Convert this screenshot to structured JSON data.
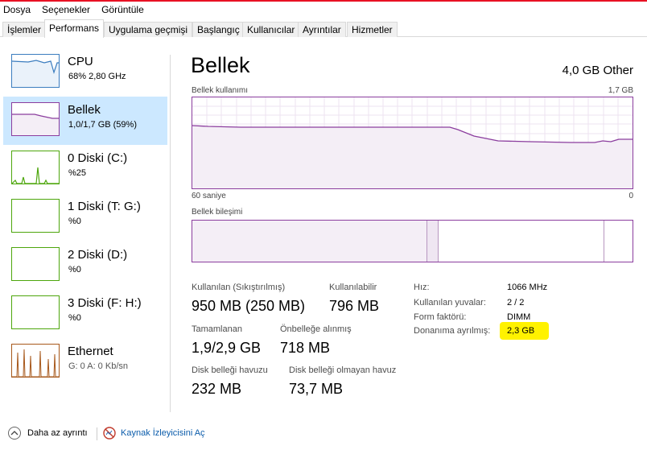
{
  "menu": [
    "Dosya",
    "Seçenekler",
    "Görüntüle"
  ],
  "tabs": [
    "İşlemler",
    "Performans",
    "Uygulama geçmişi",
    "Başlangıç",
    "Kullanıcılar",
    "Ayrıntılar",
    "Hizmetler"
  ],
  "active_tab": "Performans",
  "sidebar": {
    "items": [
      {
        "name": "CPU",
        "sub": "68%  2,80 GHz",
        "icon": "cpu-graph"
      },
      {
        "name": "Bellek",
        "sub": "1,0/1,7 GB (59%)",
        "icon": "memory-graph",
        "selected": true
      },
      {
        "name": "0 Diski (C:)",
        "sub": "%25",
        "icon": "disk-graph"
      },
      {
        "name": "1 Diski (T: G:)",
        "sub": "%0",
        "icon": "disk-graph"
      },
      {
        "name": "2 Diski (D:)",
        "sub": "%0",
        "icon": "disk-graph"
      },
      {
        "name": "3 Diski (F: H:)",
        "sub": "%0",
        "icon": "disk-graph"
      },
      {
        "name": "Ethernet",
        "sub": "G: 0  A: 0 Kb/sn",
        "icon": "network-graph"
      }
    ]
  },
  "main": {
    "title": "Bellek",
    "device": "4,0 GB Other",
    "usage_label": "Bellek kullanımı",
    "usage_max": "1,7 GB",
    "time_left": "60 saniye",
    "time_right": "0",
    "composition_label": "Bellek bileşimi",
    "stats": {
      "in_use_label": "Kullanılan (Sıkıştırılmış)",
      "in_use_value": "950 MB (250 MB)",
      "available_label": "Kullanılabilir",
      "available_value": "796 MB",
      "committed_label": "Tamamlanan",
      "committed_value": "1,9/2,9 GB",
      "cached_label": "Önbelleğe alınmış",
      "cached_value": "718 MB",
      "paged_label": "Disk belleği havuzu",
      "paged_value": "232 MB",
      "nonpaged_label": "Disk belleği olmayan havuz",
      "nonpaged_value": "73,7 MB"
    },
    "details": [
      {
        "label": "Hız:",
        "value": "1066 MHz"
      },
      {
        "label": "Kullanılan yuvalar:",
        "value": "2 / 2"
      },
      {
        "label": "Form faktörü:",
        "value": "DIMM"
      },
      {
        "label": "Donanıma ayrılmış:",
        "value": "2,3 GB"
      }
    ]
  },
  "footer": {
    "fewer_details": "Daha az ayrıntı",
    "resource_monitor": "Kaynak İzleyicisini Aç"
  },
  "colors": {
    "memory_line": "#8b3d9e",
    "memory_fill": "#f4eef6",
    "cpu_line": "#3b7dbf",
    "disk_line": "#4da60c",
    "network_line": "#a7581b",
    "selected_bg": "#cce8ff",
    "highlight": "#fff200",
    "accent_topline": "#e81123"
  }
}
